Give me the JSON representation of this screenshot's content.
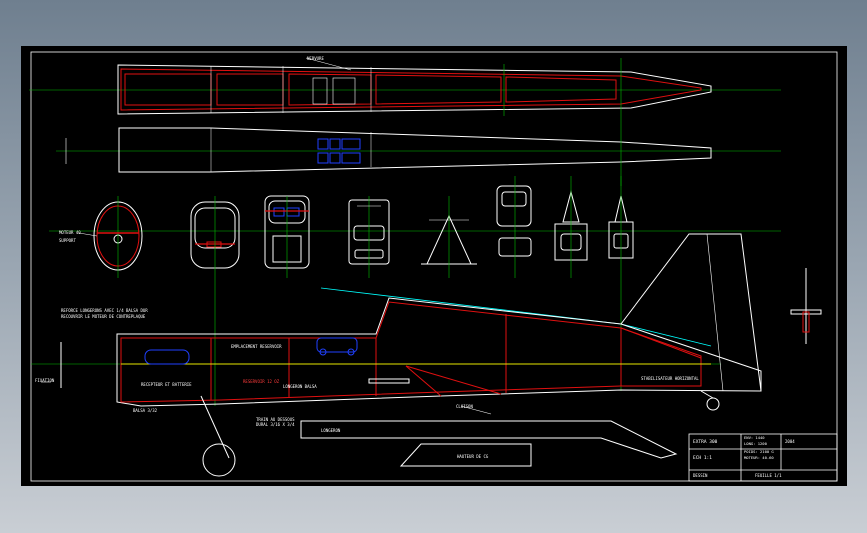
{
  "colors": {
    "background": "#000000",
    "outline": "#ffffff",
    "structure": "#e01010",
    "centerline": "#00c000",
    "yellow": "#e6e600",
    "blue": "#2040ff",
    "cyan": "#00ffff"
  },
  "labels": {
    "fuse_note_1": "REFORCE LONGERONS AVEC 1/4 BALSA DUR",
    "fuse_note_2": "RECOUVRIR LE MOTEUR DE CONTREPLAQUE",
    "fuel_tank_label": "EMPLACEMENT RESERVOIR",
    "battery_label": "RECEPTEUR ET BATTERIE",
    "tank_red_label": "RESERVOIR 12 OZ",
    "spar_label": "LONGERON BALSA",
    "firewall_label": "CLOISON",
    "tail_label": "STABILISATEUR HORIZONTAL",
    "gear_note_1": "TRAIN AU DESSOUS",
    "gear_note_2": "DURAL 3/16 X 3/4",
    "bottom_note": "HAUTEUR DE CG",
    "small_part_label": "FIXATION",
    "wing_label": "NERVURE",
    "engine_label_1": "MOTEUR 40",
    "engine_label_2": "SUPPORT",
    "bottom_left": "BALSA 3/32",
    "bottom_mid": "LONGERON"
  },
  "title_block": {
    "name": "EXTRA 300",
    "scale": "ECH 1:1",
    "spec_1": "ENV: 1440",
    "spec_2": "LONG: 1200",
    "spec_3": "POIDS: 2100 G",
    "spec_4": "MOTEUR: 40-60",
    "date": "2004",
    "drawn": "DESSIN",
    "sheet": "FEUILLE 1/1"
  }
}
